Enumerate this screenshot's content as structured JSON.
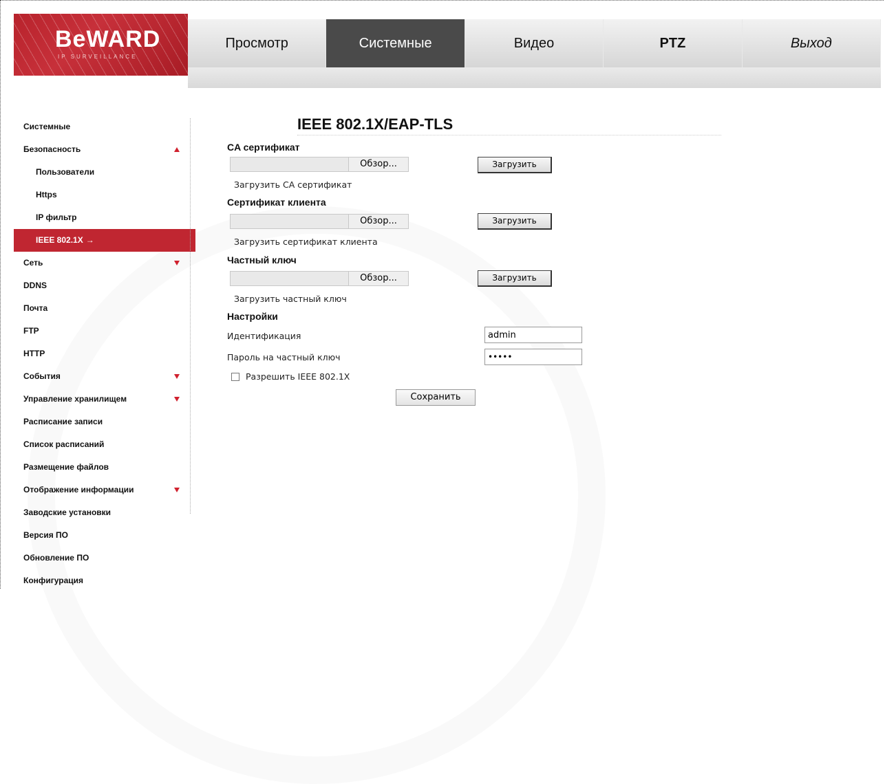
{
  "brand": {
    "logo_text": "BeWARD",
    "logo_subtext": "IP SURVEILLANCE"
  },
  "nav": {
    "items": [
      {
        "label": "Просмотр"
      },
      {
        "label": "Системные"
      },
      {
        "label": "Видео"
      },
      {
        "label": "PTZ"
      },
      {
        "label": "Выход"
      }
    ],
    "active": "Системные"
  },
  "sidebar": {
    "items": [
      {
        "label": "Системные"
      },
      {
        "label": "Безопасность",
        "indicator": "collapse-up"
      },
      {
        "label": "Пользователи"
      },
      {
        "label": "Https"
      },
      {
        "label": "IP фильтр"
      },
      {
        "label": "IEEE 802.1X",
        "arrow": "→"
      },
      {
        "label": "Сеть",
        "indicator": "expand-down"
      },
      {
        "label": "DDNS"
      },
      {
        "label": "Почта"
      },
      {
        "label": "FTP"
      },
      {
        "label": "HTTP"
      },
      {
        "label": "События",
        "indicator": "expand-down"
      },
      {
        "label": "Управление хранилищем",
        "indicator": "expand-down"
      },
      {
        "label": "Расписание записи"
      },
      {
        "label": "Список расписаний"
      },
      {
        "label": "Размещение файлов"
      },
      {
        "label": "Отображение информации",
        "indicator": "expand-down"
      },
      {
        "label": "Заводские установки"
      },
      {
        "label": "Версия ПО"
      },
      {
        "label": "Обновление ПО"
      },
      {
        "label": "Конфигурация"
      }
    ]
  },
  "main": {
    "title": "IEEE 802.1X/EAP-TLS",
    "ca": {
      "label": "CA сертификат",
      "browse": "Обзор...",
      "upload": "Загрузить",
      "hint": "Загрузить CA сертификат"
    },
    "client": {
      "label": "Сертификат клиента",
      "browse": "Обзор...",
      "upload": "Загрузить",
      "hint": "Загрузить сертификат клиента"
    },
    "key": {
      "label": "Частный ключ",
      "browse": "Обзор...",
      "upload": "Загрузить",
      "hint": "Загрузить частный ключ"
    },
    "settings": {
      "label": "Настройки",
      "identity_label": "Идентификация",
      "identity_value": "admin",
      "password_label": "Пароль на частный ключ",
      "password_value": "•••••",
      "enable_label": "Разрешить IEEE 802.1X",
      "enable_checked": false,
      "save": "Сохранить"
    }
  },
  "colors": {
    "accent": "#c02631",
    "nav_active": "#4a4a4a"
  }
}
